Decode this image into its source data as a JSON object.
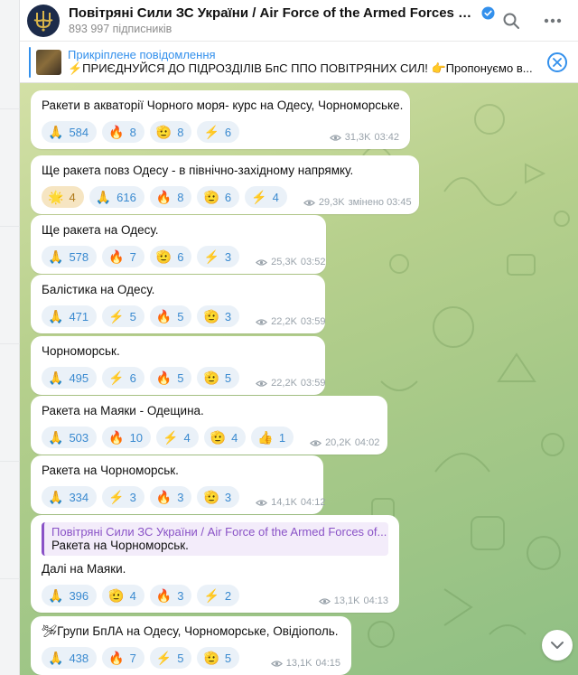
{
  "header": {
    "title": "Повітряні Сили ЗС України / Air Force of the Armed Forces of Ukr...",
    "subscribers": "893 997 підписників"
  },
  "pinned": {
    "label": "Прикріплене повідомлення",
    "text": "⚡️ПРИЄДНУЙСЯ ДО ПІДРОЗДІЛІВ БпС ППО ПОВІТРЯНИХ СИЛ! 👉Пропонуємо в..."
  },
  "messages": [
    {
      "text": "Ракети в акваторії Чорного моря- курс на Одесу, Чорноморське.",
      "reactions": [
        {
          "emoji": "🙏",
          "count": "584"
        },
        {
          "emoji": "🔥",
          "count": "8"
        },
        {
          "emoji": "🫡",
          "count": "8"
        },
        {
          "emoji": "⚡",
          "count": "6"
        }
      ],
      "views": "31,3K",
      "time": "03:42"
    },
    {
      "text": "Ще ракета повз Одесу - в північно-західному напрямку.",
      "reactions": [
        {
          "emoji": "🌟",
          "count": "4",
          "active": true
        },
        {
          "emoji": "🙏",
          "count": "616"
        },
        {
          "emoji": "🔥",
          "count": "8"
        },
        {
          "emoji": "🫡",
          "count": "6"
        },
        {
          "emoji": "⚡",
          "count": "4"
        }
      ],
      "views": "29,3K",
      "time": "змінено 03:45"
    },
    {
      "text": "Ще ракета на Одесу.",
      "reactions": [
        {
          "emoji": "🙏",
          "count": "578"
        },
        {
          "emoji": "🔥",
          "count": "7"
        },
        {
          "emoji": "🫡",
          "count": "6"
        },
        {
          "emoji": "⚡",
          "count": "3"
        }
      ],
      "views": "25,3K",
      "time": "03:52"
    },
    {
      "text": "Балістика на Одесу.",
      "reactions": [
        {
          "emoji": "🙏",
          "count": "471"
        },
        {
          "emoji": "⚡",
          "count": "5"
        },
        {
          "emoji": "🔥",
          "count": "5"
        },
        {
          "emoji": "🫡",
          "count": "3"
        }
      ],
      "views": "22,2K",
      "time": "03:59"
    },
    {
      "text": "Чорноморськ.",
      "reactions": [
        {
          "emoji": "🙏",
          "count": "495"
        },
        {
          "emoji": "⚡",
          "count": "6"
        },
        {
          "emoji": "🔥",
          "count": "5"
        },
        {
          "emoji": "🫡",
          "count": "5"
        }
      ],
      "views": "22,2K",
      "time": "03:59"
    },
    {
      "text": "Ракета на Маяки - Одещина.",
      "reactions": [
        {
          "emoji": "🙏",
          "count": "503"
        },
        {
          "emoji": "🔥",
          "count": "10"
        },
        {
          "emoji": "⚡",
          "count": "4"
        },
        {
          "emoji": "🫡",
          "count": "4"
        },
        {
          "emoji": "👍",
          "count": "1"
        }
      ],
      "views": "20,2K",
      "time": "04:02"
    },
    {
      "text": "Ракета на Чорноморськ.",
      "reactions": [
        {
          "emoji": "🙏",
          "count": "334"
        },
        {
          "emoji": "⚡",
          "count": "3"
        },
        {
          "emoji": "🔥",
          "count": "3"
        },
        {
          "emoji": "🫡",
          "count": "3"
        }
      ],
      "views": "14,1K",
      "time": "04:12"
    },
    {
      "reply_from": "Повітряні Сили ЗС України / Air Force of the Armed Forces of...",
      "reply_text": "Ракета на Чорноморськ.",
      "text": "Далі на Маяки.",
      "reactions": [
        {
          "emoji": "🙏",
          "count": "396"
        },
        {
          "emoji": "🫡",
          "count": "4"
        },
        {
          "emoji": "🔥",
          "count": "3"
        },
        {
          "emoji": "⚡",
          "count": "2"
        }
      ],
      "views": "13,1K",
      "time": "04:13"
    },
    {
      "text": "🛩Групи БпЛА на Одесу, Чорноморське, Овідіополь.",
      "reactions": [
        {
          "emoji": "🙏",
          "count": "438"
        },
        {
          "emoji": "🔥",
          "count": "7"
        },
        {
          "emoji": "⚡",
          "count": "5"
        },
        {
          "emoji": "🫡",
          "count": "5"
        }
      ],
      "views": "13,1K",
      "time": "04:15"
    }
  ]
}
